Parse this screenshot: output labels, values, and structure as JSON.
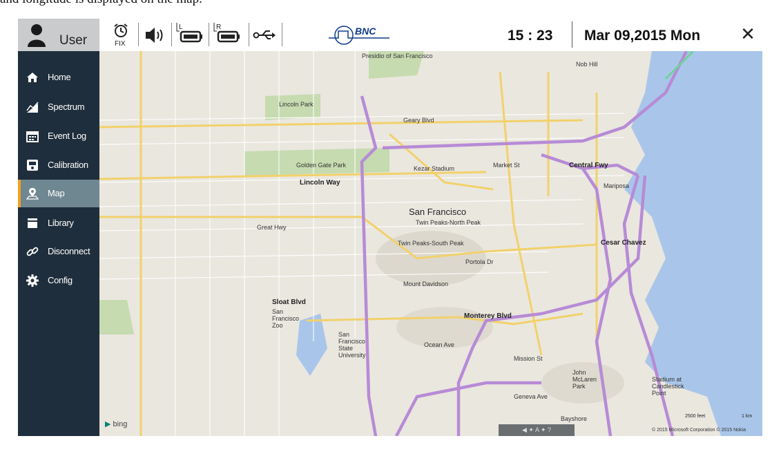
{
  "caption": "and longitude is displayed on the map.",
  "topbar": {
    "user_label": "User",
    "alarm_label": "FIX",
    "left_battery_label": "L",
    "right_battery_label": "R",
    "connection_label": "BNC",
    "time": "15 : 23",
    "date": "Mar 09,2015 Mon",
    "close_label": "✕",
    "icons": [
      "alarm-clock-icon",
      "speaker-icon",
      "battery-left-icon",
      "battery-right-icon",
      "usb-icon",
      "bnc-pulse-icon",
      "close-icon"
    ]
  },
  "sidebar": {
    "items": [
      {
        "label": "Home",
        "icon": "home-icon"
      },
      {
        "label": "Spectrum",
        "icon": "spectrum-icon"
      },
      {
        "label": "Event Log",
        "icon": "calendar-icon"
      },
      {
        "label": "Calibration",
        "icon": "calibration-icon"
      },
      {
        "label": "Map",
        "icon": "map-pin-icon",
        "active": true
      },
      {
        "label": "Library",
        "icon": "library-icon"
      },
      {
        "label": "Disconnect",
        "icon": "link-icon"
      },
      {
        "label": "Config",
        "icon": "gear-icon"
      }
    ]
  },
  "map": {
    "labels": {
      "presidio": "Presidio of San Francisco",
      "nob_hill": "Nob Hill",
      "lincoln_park": "Lincoln Park",
      "geary_blvd": "Geary Blvd",
      "golden_gate_park": "Golden Gate Park",
      "lincoln_way": "Lincoln Way",
      "central_fwy": "Central Fwy",
      "san_francisco": "San Francisco",
      "twin_peaks_north": "Twin Peaks-North Peak",
      "twin_peaks_south": "Twin Peaks-South Peak",
      "cesar_chavez": "Cesar Chavez",
      "mount_davidson": "Mount Davidson",
      "monterey_blvd": "Monterey Blvd",
      "sloat_blvd": "Sloat Blvd",
      "sf_zoo": "San Francisco Zoo",
      "sf_state": "San Francisco State University",
      "ocean_ave": "Ocean Ave",
      "mission_st": "Mission St",
      "john_mclaren": "John McLaren Park",
      "stadium": "Stadium at Candlestick Point",
      "bayshore": "Bayshore",
      "great_hwy": "Great Hwy",
      "market_st": "Market St",
      "portola_dr": "Portola Dr",
      "geneva_ave": "Geneva Ave",
      "mariposa": "Mariposa",
      "kezar": "Kezar Stadium"
    },
    "bing_label": "bing",
    "scale_feet": "2500 feet",
    "scale_km": "1 km",
    "copyright": "© 2015 Microsoft Corporation   © 2015 Nokia"
  }
}
